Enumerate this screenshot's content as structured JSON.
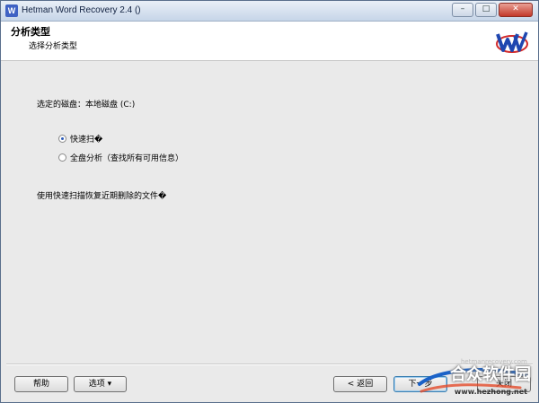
{
  "window": {
    "title": "Hetman Word Recovery 2.4 ()",
    "minimize": "–",
    "maximize": "□",
    "close": "✕"
  },
  "header": {
    "title": "分析类型",
    "subtitle": "选择分析类型"
  },
  "content": {
    "disk_label": "选定的磁盘：本地磁盘 (C:)",
    "options": [
      {
        "label": "快速扫�",
        "selected": true
      },
      {
        "label": "全盘分析（查找所有可用信息）",
        "selected": false
      }
    ],
    "description": "使用快速扫描恢复近期删除的文件�"
  },
  "footer": {
    "help": "帮助",
    "options": "选项 ▾",
    "back": "< 返回",
    "next": "下一步",
    "close": "关闭"
  },
  "watermark": {
    "brand": "合众软件园",
    "url": "www.hezhong.net",
    "url2": "hetmanrecovery.com"
  },
  "colors": {
    "accent": "#2d5cb8",
    "titlebar": "#c6d5e8"
  }
}
